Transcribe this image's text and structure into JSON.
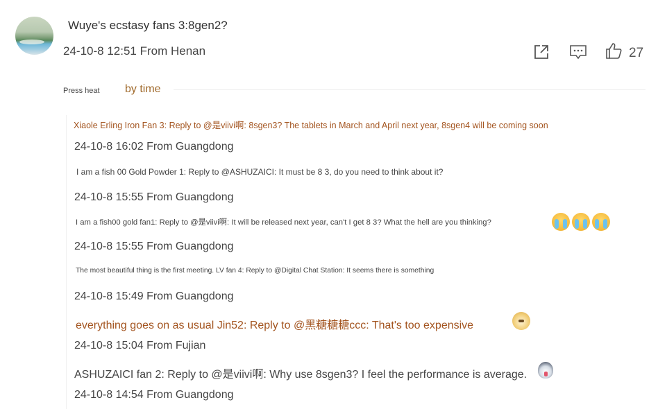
{
  "post": {
    "text": "Wuye's ecstasy fans 3:8gen2?",
    "meta": "24-10-8 12:51 From Henan",
    "like_count": "27",
    "icons": [
      "share-icon",
      "comment-icon",
      "like-icon"
    ]
  },
  "sort": {
    "heat_label": "Press heat",
    "time_label": "by time"
  },
  "replies": [
    {
      "text": "Xiaole Erling Iron Fan 3: Reply to @是viivi啊: 8sgen3? The tablets in March and April next year, 8sgen4 will be coming soon",
      "meta": "24-10-8 16:02 From Guangdong",
      "emojis": []
    },
    {
      "text": "I am a fish 00 Gold Powder 1: Reply to @ASHUZAICI: It must be 8 3, do you need to think about it?",
      "meta": "24-10-8 15:55 From Guangdong",
      "emojis": []
    },
    {
      "text": "I am a fish00 gold fan1: Reply to @是viivi啊: It will be released next year, can't I get 8 3? What the hell are you thinking?",
      "meta": "24-10-8 15:55 From Guangdong",
      "emojis": [
        "crying-emoji",
        "crying-emoji",
        "crying-emoji"
      ]
    },
    {
      "text": "The most beautiful thing is the first meeting. LV fan 4: Reply to @Digital Chat Station: It seems there is something",
      "meta": "24-10-8 15:49 From Guangdong",
      "emojis": []
    },
    {
      "text": "everything goes on as usual Jin52: Reply to @黑糖糖糖ccc: That's too expensive",
      "meta": "24-10-8 15:04 From Fujian",
      "emojis": [
        "doge-emoji"
      ]
    },
    {
      "text": "ASHUZAICI fan 2: Reply to @是viivi啊: Why use 8sgen3? I feel the performance is average.",
      "meta": "24-10-8 14:54 From Guangdong",
      "emojis": [
        "husky-emoji"
      ]
    }
  ],
  "colors": {
    "accent_brown": "#a06a2c",
    "reply_brown": "#a3541f",
    "emoji_tear": "#6cc2ec"
  }
}
